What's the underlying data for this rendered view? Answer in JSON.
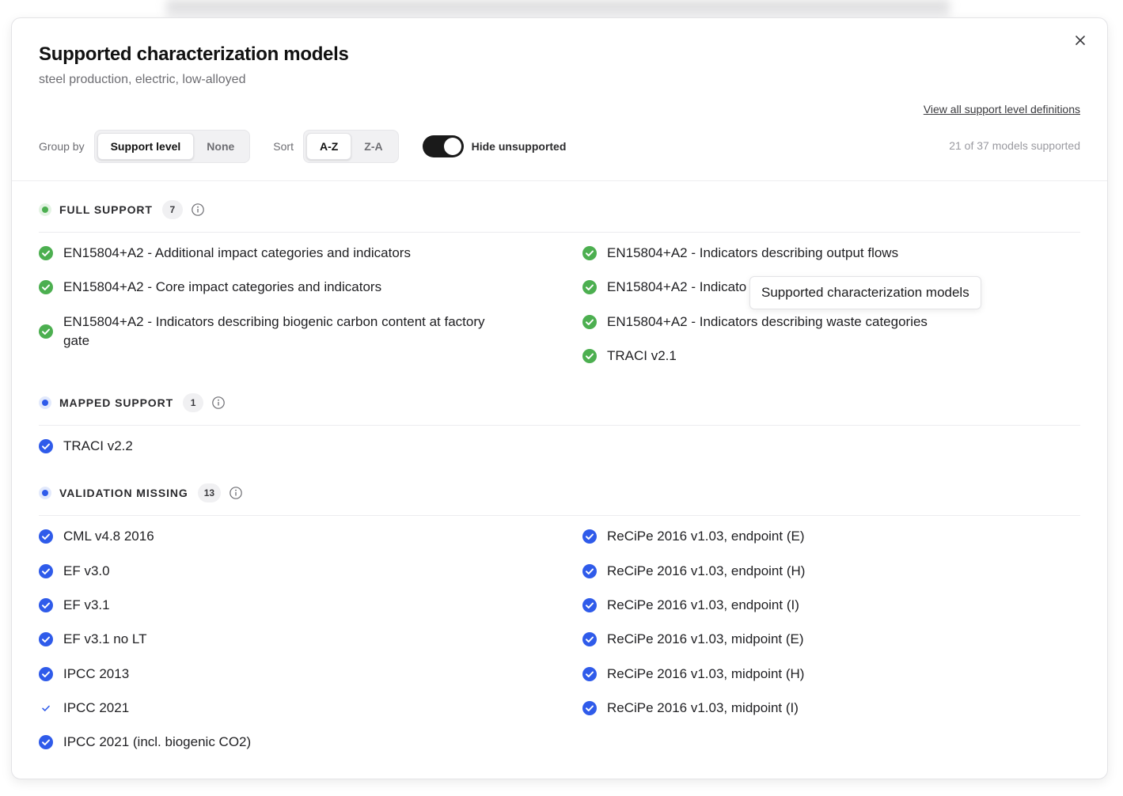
{
  "dialog": {
    "title": "Supported characterization models",
    "subtitle": "steel production, electric, low-alloyed",
    "defs_link": "View all support level definitions"
  },
  "controls": {
    "group_by_label": "Group by",
    "group_options": [
      "Support level",
      "None"
    ],
    "sort_label": "Sort",
    "sort_options": [
      "A-Z",
      "Z-A"
    ],
    "toggle_label": "Hide unsupported",
    "toggle_on": true,
    "count_text": "21 of 37 models supported"
  },
  "colors": {
    "full_support": "#4caf50",
    "mapped_support": "#2f5bea",
    "validation_missing": "#2f5bea"
  },
  "sections": {
    "full": {
      "title": "FULL SUPPORT",
      "count": "7",
      "left": [
        "EN15804+A2 - Additional impact categories and indicators",
        "EN15804+A2 - Core impact categories and indicators",
        "EN15804+A2 - Indicators describing biogenic carbon content at factory gate"
      ],
      "right": [
        "EN15804+A2 - Indicators describing output flows",
        "EN15804+A2 - Indicato",
        "EN15804+A2 - Indicators describing waste categories",
        "TRACI v2.1"
      ]
    },
    "mapped": {
      "title": "MAPPED SUPPORT",
      "count": "1",
      "left": [
        "TRACI v2.2"
      ]
    },
    "validation": {
      "title": "VALIDATION MISSING",
      "count": "13",
      "left": [
        "CML v4.8 2016",
        "EF v3.0",
        "EF v3.1",
        "EF v3.1 no LT",
        "IPCC 2013",
        "IPCC 2021",
        "IPCC 2021 (incl. biogenic CO2)"
      ],
      "right": [
        "ReCiPe 2016 v1.03, endpoint (E)",
        "ReCiPe 2016 v1.03, endpoint (H)",
        "ReCiPe 2016 v1.03, endpoint (I)",
        "ReCiPe 2016 v1.03, midpoint (E)",
        "ReCiPe 2016 v1.03, midpoint (H)",
        "ReCiPe 2016 v1.03, midpoint (I)"
      ]
    }
  },
  "tooltip": "Supported characterization models"
}
